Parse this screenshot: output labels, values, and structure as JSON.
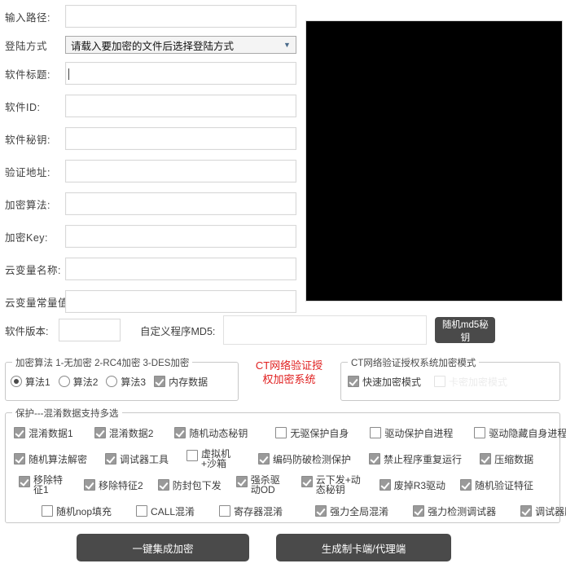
{
  "form": {
    "fields": [
      {
        "label": "输入路径:",
        "value": "",
        "name": "input-path"
      },
      {
        "label": "软件标题:",
        "value": "",
        "name": "software-title"
      },
      {
        "label": "软件ID:",
        "value": "",
        "name": "software-id"
      },
      {
        "label": "软件秘钥:",
        "value": "",
        "name": "software-key"
      },
      {
        "label": "验证地址:",
        "value": "",
        "name": "verify-url"
      },
      {
        "label": "加密算法:",
        "value": "",
        "name": "encrypt-algorithm"
      },
      {
        "label": "加密Key:",
        "value": "",
        "name": "encrypt-key"
      },
      {
        "label": "云变量名称:",
        "value": "",
        "name": "cloud-var-name"
      },
      {
        "label": "云变量常量值",
        "value": "",
        "name": "cloud-var-const"
      }
    ],
    "login_mode": {
      "label": "登陆方式",
      "selected": "请载入要加密的文件后选择登陆方式",
      "arrow_icon": "chevron-down-icon"
    }
  },
  "version_row": {
    "version_label": "软件版本:",
    "version_value": "",
    "md5_label": "自定义程序MD5:",
    "md5_value": "",
    "md5_button": "随机md5秘钥"
  },
  "algo_group": {
    "title": "加密算法 1-无加密 2-RC4加密 3-DES加密",
    "options": [
      {
        "label": "算法1",
        "type": "radio",
        "checked": true
      },
      {
        "label": "算法2",
        "type": "radio",
        "checked": false
      },
      {
        "label": "算法3",
        "type": "radio",
        "checked": false
      },
      {
        "label": "内存数据",
        "type": "checkbox",
        "checked": true
      }
    ]
  },
  "brand": {
    "line1": "CT网络验证授",
    "line2": "权加密系统",
    "color": "#e02020"
  },
  "ct_group": {
    "title": "CT网络验证授权系统加密模式",
    "options": [
      {
        "label": "快速加密模式",
        "checked": true,
        "disabled": false
      },
      {
        "label": "卡密加密模式",
        "checked": false,
        "disabled": true
      }
    ]
  },
  "protect_group": {
    "title": "保护---混淆数据支持多选",
    "rows": [
      [
        {
          "label": "混淆数据1",
          "checked": true
        },
        {
          "label": "混淆数据2",
          "checked": true
        },
        {
          "label": "随机动态秘钥",
          "checked": true
        },
        {
          "label": "无驱保护自身",
          "checked": false
        },
        {
          "label": "驱动保护自进程",
          "checked": false
        },
        {
          "label": "驱动隐藏自身进程",
          "checked": false
        }
      ],
      [
        {
          "label": "随机算法解密",
          "checked": true
        },
        {
          "label": "调试器工具",
          "checked": true
        },
        {
          "label": "虚拟机+沙箱",
          "checked": false,
          "wrap": true
        },
        {
          "label": "编码防破检测保护",
          "checked": true
        },
        {
          "label": "禁止程序重复运行",
          "checked": true
        },
        {
          "label": "压缩数据",
          "checked": true
        }
      ],
      [
        {
          "label": "移除特征1",
          "checked": true,
          "wrap": true
        },
        {
          "label": "移除特征2",
          "checked": true
        },
        {
          "label": "防封包下发",
          "checked": true
        },
        {
          "label": "强杀驱动OD",
          "checked": true,
          "wrap": true
        },
        {
          "label": "云下发+动态秘钥",
          "checked": true,
          "wrap": true
        },
        {
          "label": "废掉R3驱动",
          "checked": true
        },
        {
          "label": "随机验证特征",
          "checked": true
        }
      ],
      [
        {
          "label": "随机nop填充",
          "checked": false
        },
        {
          "label": "CALL混淆",
          "checked": false
        },
        {
          "label": "寄存器混淆",
          "checked": false
        },
        {
          "label": "强力全局混淆",
          "checked": true
        },
        {
          "label": "强力检测调试器",
          "checked": true
        },
        {
          "label": "调试器脱钩",
          "checked": true
        }
      ]
    ]
  },
  "buttons": {
    "integrate": "一键集成加密",
    "generate": "生成制卡端/代理端"
  }
}
